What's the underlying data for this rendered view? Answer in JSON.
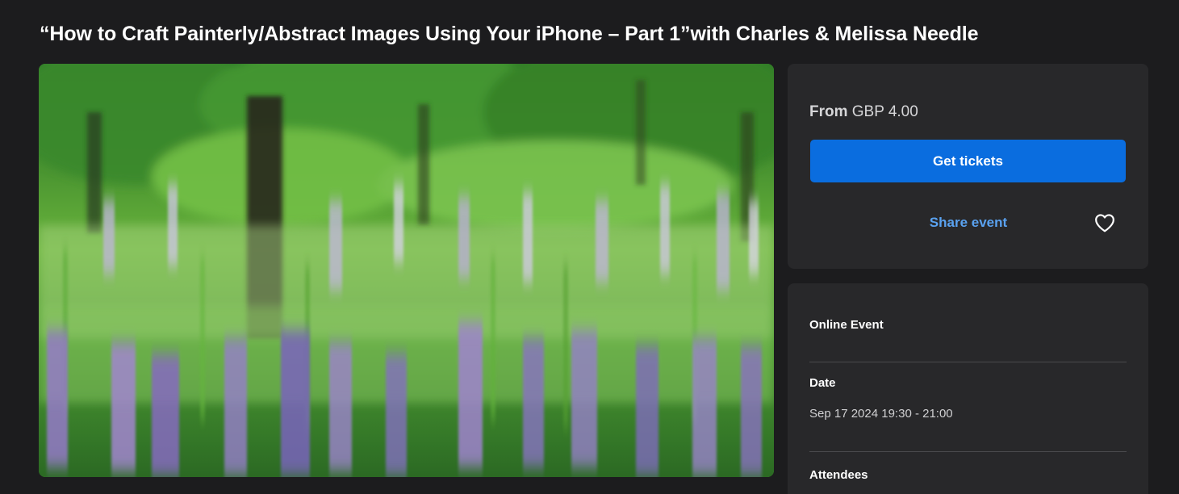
{
  "event": {
    "title": "“How to Craft Painterly/Abstract Images Using Your iPhone – Part 1”with Charles & Melissa Needle",
    "image_alt": "Blurred painterly photo of purple lupines in a green meadow with trees"
  },
  "ticket_panel": {
    "price_prefix": "From",
    "price_value": "GBP 4.00",
    "get_tickets_label": "Get tickets",
    "share_label": "Share event",
    "favorite_icon": "heart-icon",
    "button_color": "#0a6ddf",
    "link_color": "#5aa2f0"
  },
  "details": {
    "event_type": "Online Event",
    "date_label": "Date",
    "date_value": "Sep 17 2024 19:30 - 21:00",
    "attendees_label": "Attendees"
  }
}
